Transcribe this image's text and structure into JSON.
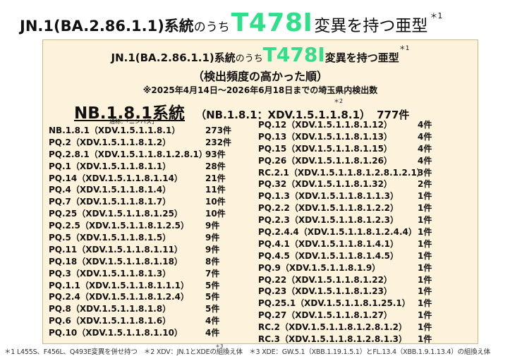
{
  "title": {
    "part1": "JN.1(BA.2.86.1.1)系統",
    "part2": "のうち",
    "mutation": "T478I",
    "part3": "変異を持つ亜型",
    "footnote_mark": "＊1"
  },
  "panel": {
    "title": {
      "part1": "JN.1(BA.2.86.1.1)系統",
      "part2": "のうち",
      "mutation": "T478I",
      "part3": "変異を持つ亜型",
      "footnote_mark": "＊1"
    },
    "subtitle": "（検出頻度の高かった順）",
    "note": "※2025年4月14日～2026年6月18日までの埼玉県内検出数",
    "lineage": {
      "name": "NB.1.8.1系統",
      "alias": "（NB.1.8.1：XDV.1.5.1.1.8.1）",
      "count": "777件",
      "mark": "＊2",
      "nickname": "通称：「ニンバス」"
    },
    "left_items": [
      {
        "name": "NB.1.8.1（XDV.1.5.1.1.8.1）",
        "count": "273件"
      },
      {
        "name": "PQ.2（XDV.1.5.1.1.8.1.2）",
        "count": "232件"
      },
      {
        "name": "PQ.2.8.1（XDV.1.5.1.1.8.1.2.8.1）",
        "count": "93件"
      },
      {
        "name": "PQ.1（XDV.1.5.1.1.8.1.1）",
        "count": "28件"
      },
      {
        "name": "PQ.14（XDV.1.5.1.1.8.1.14）",
        "count": "21件"
      },
      {
        "name": "PQ.4（XDV.1.5.1.1.8.1.4）",
        "count": "11件"
      },
      {
        "name": "PQ.7（XDV.1.5.1.1.8.1.7）",
        "count": "10件"
      },
      {
        "name": "PQ.25（XDV.1.5.1.1.8.1.25）",
        "count": "10件"
      },
      {
        "name": "PQ.2.5（XDV.1.5.1.1.8.1.2.5）",
        "count": "9件"
      },
      {
        "name": "PQ.5（XDV.1.5.1.1.8.1.5）",
        "count": "9件"
      },
      {
        "name": "PQ.11（XDV.1.5.1.1.8.1.11）",
        "count": "9件"
      },
      {
        "name": "PQ.18（XDV.1.5.1.1.8.1.18）",
        "count": "8件"
      },
      {
        "name": "PQ.3（XDV.1.5.1.1.8.1.3）",
        "count": "7件"
      },
      {
        "name": "PQ.1.1（XDV.1.5.1.1.8.1.1.1）",
        "count": "5件"
      },
      {
        "name": "PQ.2.4（XDV.1.5.1.1.8.1.2.4）",
        "count": "5件"
      },
      {
        "name": "PQ.8（XDV.1.5.1.1.8.1.8）",
        "count": "5件"
      },
      {
        "name": "PQ.6（XDV.1.5.1.1.8.1.6）",
        "count": "4件"
      },
      {
        "name": "PQ.10（XDV.1.5.1.1.8.1.10）",
        "count": "4件"
      }
    ],
    "right_items": [
      {
        "name": "PQ.12（XDV.1.5.1.1.8.1.12）",
        "count": "4件"
      },
      {
        "name": "PQ.13（XDV.1.5.1.1.8.1.13）",
        "count": "4件"
      },
      {
        "name": "PQ.15（XDV.1.5.1.1.8.1.15）",
        "count": "4件"
      },
      {
        "name": "PQ.26（XDV.1.5.1.1.8.1.26）",
        "count": "4件"
      },
      {
        "name": "RC.2.1（XDV.1.5.1.1.8.1.2.8.1.2.1）",
        "count": "3件"
      },
      {
        "name": "PQ.32（XDV.1.5.1.1.8.1.32）",
        "count": "2件"
      },
      {
        "name": "PQ.1.3（XDV.1.5.1.1.8.1.1.3）",
        "count": "1件"
      },
      {
        "name": "PQ.2.2（XDV.1.5.1.1.8.1.2.2）",
        "count": "1件"
      },
      {
        "name": "PQ.2.3（XDV.1.5.1.1.8.1.2.3）",
        "count": "1件"
      },
      {
        "name": "PQ.2.4.4（XDV.1.5.1.1.8.1.2.4.4）",
        "count": "1件"
      },
      {
        "name": "PQ.4.1（XDV.1.5.1.1.8.1.4.1）",
        "count": "1件"
      },
      {
        "name": "PQ.4.5（XDV.1.5.1.1.8.1.4.5）",
        "count": "1件"
      },
      {
        "name": "PQ.9（XDV.1.5.1.1.8.1.9）",
        "count": "1件"
      },
      {
        "name": "PQ.22（XDV.1.5.1.1.8.1.22）",
        "count": "1件"
      },
      {
        "name": "PQ.23（XDV.1.5.1.1.8.1.23）",
        "count": "1件"
      },
      {
        "name": "PQ.25.1（XDV.1.5.1.1.8.1.25.1）",
        "count": "1件"
      },
      {
        "name": "PQ.27（XDV.1.5.1.1.8.1.27）",
        "count": "1件"
      },
      {
        "name": "RC.2（XDV.1.5.1.1.8.1.2.8.1.2）",
        "count": "1件"
      },
      {
        "name": "RC.3（XDV.1.5.1.1.8.1.2.8.1.3）",
        "count": "1件"
      }
    ]
  },
  "footnotes": {
    "text": "＊1 L455S、F456L、Q493E変異を併せ持つ　＊2 XDV：JN.1とXDEの組換え体　＊3 XDE：GW.5.1（XBB.1.19.1.5.1）とFL.13.4（XBB.1.9.1.13.4）の組換え体",
    "mark": "＊3"
  }
}
